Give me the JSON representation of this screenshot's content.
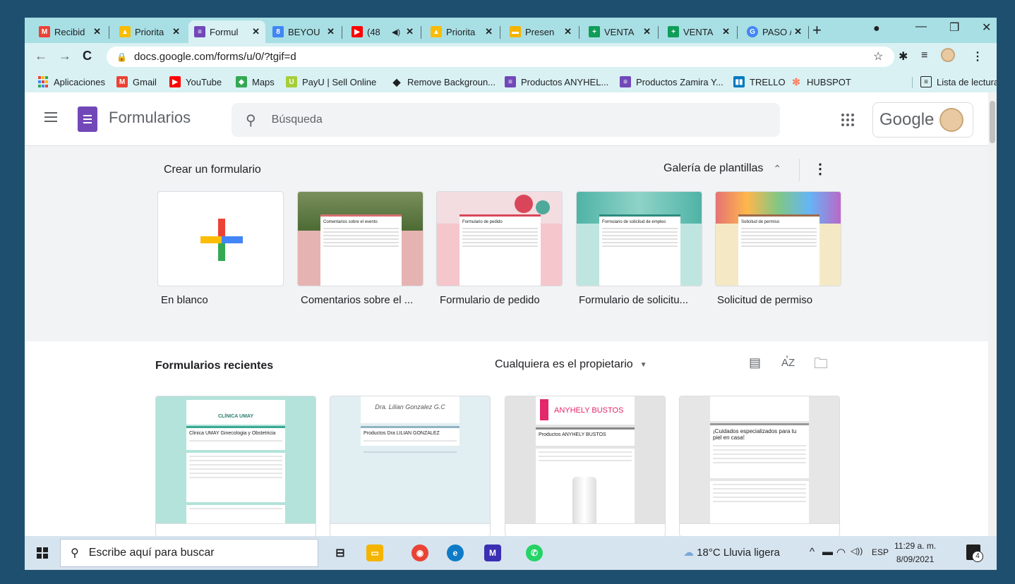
{
  "browser": {
    "tabs": [
      {
        "label": "Recibid",
        "icon": "gmail-icon",
        "color": "#ea4335"
      },
      {
        "label": "Priorita",
        "icon": "drive-icon",
        "color": "#fbbc04"
      },
      {
        "label": "Formul",
        "icon": "forms-icon",
        "color": "#7248b9"
      },
      {
        "label": "BEYOU",
        "icon": "calendar-icon",
        "color": "#4285f4"
      },
      {
        "label": "(48",
        "icon": "youtube-icon",
        "color": "#ff0000"
      },
      {
        "label": "Priorita",
        "icon": "drive-icon",
        "color": "#fbbc04"
      },
      {
        "label": "Presen",
        "icon": "slides-icon",
        "color": "#f4b400"
      },
      {
        "label": "VENTA",
        "icon": "sheets-icon",
        "color": "#0f9d58"
      },
      {
        "label": "VENTA",
        "icon": "sheets-icon",
        "color": "#0f9d58"
      },
      {
        "label": "PASO /",
        "icon": "google-icon",
        "color": "#4285f4"
      }
    ],
    "url": "docs.google.com/forms/u/0/?tgif=d",
    "bookmarks": [
      {
        "label": "Aplicaciones",
        "color": "#ea4335"
      },
      {
        "label": "Gmail",
        "color": "#ea4335"
      },
      {
        "label": "YouTube",
        "color": "#ff0000"
      },
      {
        "label": "Maps",
        "color": "#34a853"
      },
      {
        "label": "PayU | Sell Online",
        "color": "#a6ce39"
      },
      {
        "label": "Remove Backgroun...",
        "color": "#202124"
      },
      {
        "label": "Productos ANYHEL...",
        "color": "#7248b9"
      },
      {
        "label": "Productos Zamira Y...",
        "color": "#7248b9"
      },
      {
        "label": "TRELLO",
        "color": "#0079bf"
      },
      {
        "label": "HUBSPOT",
        "color": "#ff7a59"
      }
    ],
    "reading_list": "Lista de lectura"
  },
  "forms_app": {
    "name": "Formularios",
    "search_placeholder": "Búsqueda",
    "google_label": "Google"
  },
  "create": {
    "title": "Crear un formulario",
    "gallery_label": "Galería de plantillas",
    "templates": [
      {
        "name": "En blanco",
        "thumb_title": ""
      },
      {
        "name": "Comentarios sobre el ...",
        "thumb_title": "Comentarios sobre el evento"
      },
      {
        "name": "Formulario de pedido",
        "thumb_title": "Formulario de pedido"
      },
      {
        "name": "Formulario de solicitu...",
        "thumb_title": "Formulario de solicitud de empleo"
      },
      {
        "name": "Solicitud de permiso",
        "thumb_title": "Solicitud de permiso"
      }
    ]
  },
  "recent": {
    "title": "Formularios recientes",
    "owner_filter": "Cualquiera es el propietario",
    "cards": [
      {
        "brand": "CLÍNICA UMAY",
        "title": "Clinica UMAY Ginecologia y Obstetricia"
      },
      {
        "brand": "Dra. Lilian Gonzalez G.C",
        "title": "Productos Dra LILIAN GONZALEZ"
      },
      {
        "brand": "ANYHELY BUSTOS",
        "title": "Productos ANYHELY BUSTOS"
      },
      {
        "brand": "",
        "title": "¡Cuidados especializados para tu piel en casa!"
      }
    ]
  },
  "taskbar": {
    "search_placeholder": "Escribe aquí para buscar",
    "weather": "18°C  Lluvia ligera",
    "lang": "ESP",
    "time": "11:29 a. m.",
    "date": "8/09/2021",
    "notifications": "4"
  }
}
